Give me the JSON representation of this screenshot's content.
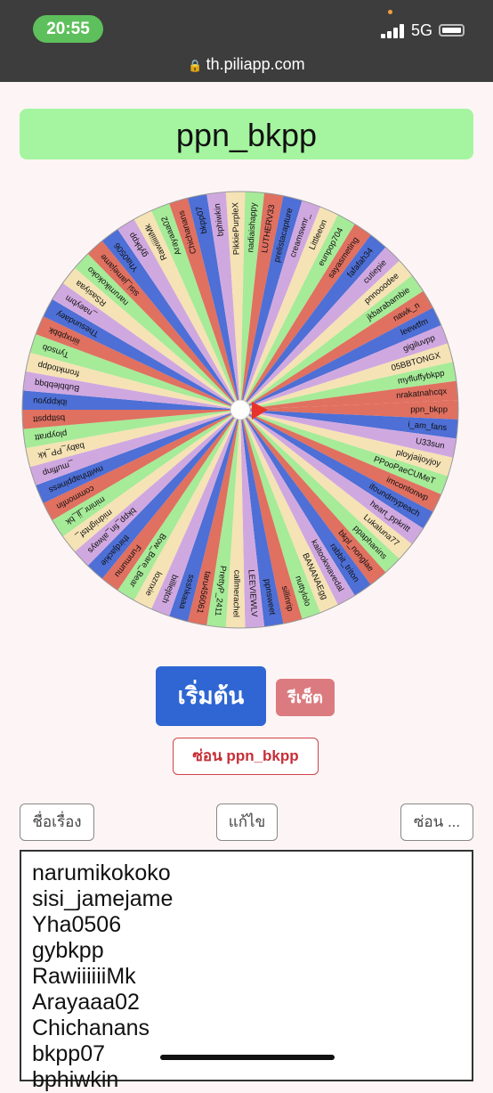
{
  "status": {
    "time": "20:55",
    "network": "5G"
  },
  "browser": {
    "url": "th.piliapp.com"
  },
  "header": {
    "title": "ppn_bkpp"
  },
  "wheel": {
    "colors": [
      "#e07060",
      "#4d6fd6",
      "#d0a8e0",
      "#f5e3b5",
      "#a6eb98"
    ],
    "names": [
      "ppn_bkpp",
      "i_am_fans",
      "U33sun",
      "ployjaijoyjoy",
      "PPooPaeCUMeT",
      "imcontonwp",
      "ifoundmypeach",
      "heart_ppkritt",
      "Lukaluna77",
      "ppaphanins",
      "bkpl_nonglae",
      "rabbit_triton",
      "kaitookwavedal",
      "BANANAEgg",
      "nuttylolo",
      "sillinrip",
      "ppnsweet",
      "LEEVIEWLV",
      "callmerachel",
      "PrettyP_2411",
      "taru456061",
      "ssshkaaa",
      "billiejtch",
      "loznxie",
      "Bow_Bare_Bear",
      "Funmumu",
      "thirdjackie",
      "bkpp_fin_always",
      "midnightsf_",
      "mininr_jj_bk",
      "commonfin",
      "nwithhappiness",
      "_muffinp",
      "baby_PP_kk",
      "ploypratt",
      "bsttppstt",
      "ibkppyou",
      "Bubblebbqq",
      "fromktodpp",
      "Tynsob",
      "iiinxpbbk",
      "Thesundaey",
      "_naeybm",
      "RSasiyaa",
      "narumikokoko",
      "sisi_jamejame",
      "Yha0506",
      "gybkpp",
      "RawiiiiiiMk",
      "Arayaaa02",
      "Chichanans",
      "bkpp07",
      "bphiwkin",
      "PikkiePurpleX",
      "nadiaishappy",
      "LUTHERV33",
      "prelistacapture",
      "creamswnr_",
      "Littleeon",
      "eunpop704",
      "sayasmeting",
      "fafafah34",
      "cutiepie",
      "pnnooodee",
      "jkbarabambie",
      "nawk_n",
      "leewtfm",
      "gigiluvpp",
      "05BBTONGX",
      "myfluffybkpp",
      "nrakatnahcqx"
    ]
  },
  "controls": {
    "start_label": "เริ่มต้น",
    "reset_label": "รีเซ็ต",
    "hide_label": "ซ่อน ppn_bkpp",
    "title_label": "ชื่อเรื่อง",
    "edit_label": "แก้ไข",
    "hide_more_label": "ซ่อน ..."
  },
  "list": {
    "names": [
      "narumikokoko",
      "sisi_jamejame",
      "Yha0506",
      "gybkpp",
      "RawiiiiiiMk",
      "Arayaaa02",
      "Chichanans",
      "bkpp07",
      "bphiwkin"
    ]
  }
}
